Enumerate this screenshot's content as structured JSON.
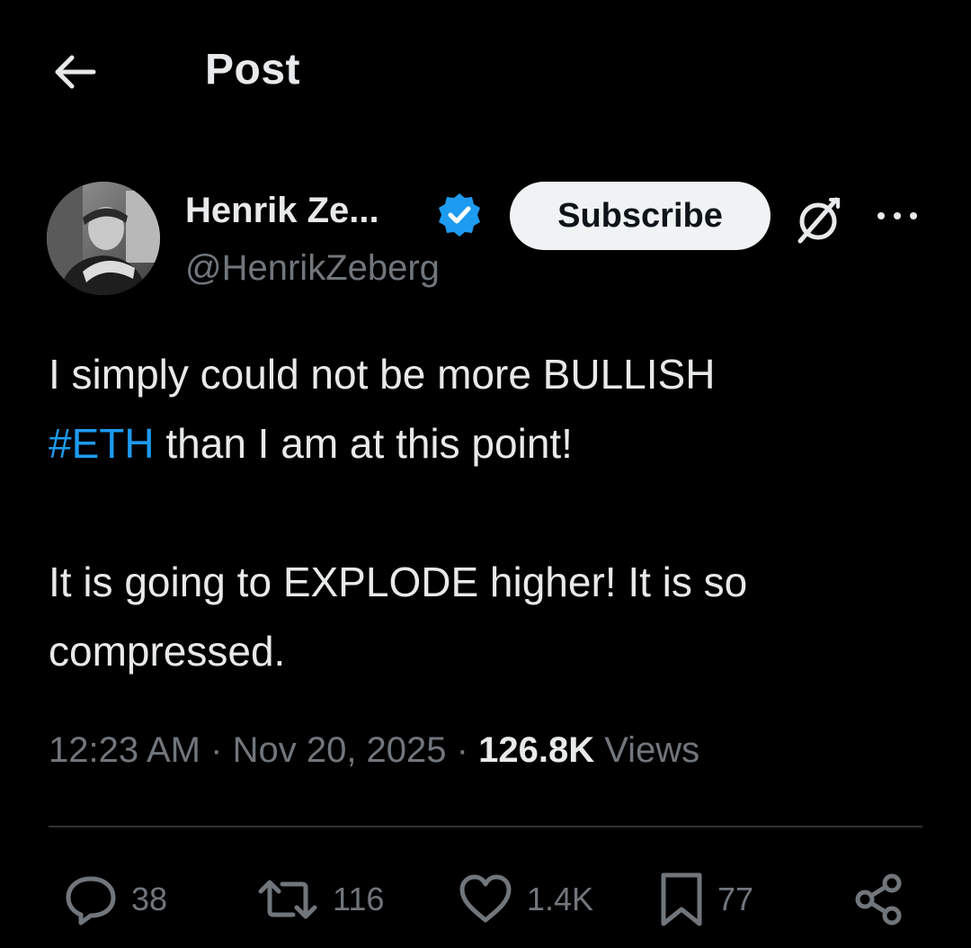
{
  "header": {
    "title": "Post"
  },
  "author": {
    "name": "Henrik Ze...",
    "handle": "@HenrikZeberg",
    "verified": true
  },
  "subscribe": {
    "label": "Subscribe"
  },
  "tweet": {
    "line1_text": "I simply could not be more BULLISH",
    "hashtag": "#ETH",
    "line2_rest": " than I am at this point!",
    "para2_line1": "It is going to EXPLODE higher! It is so",
    "para2_line2": "compressed."
  },
  "meta": {
    "time": "12:23 AM",
    "date": "Nov 20, 2025",
    "views_count": "126.8K",
    "views_label": "Views"
  },
  "actions": {
    "replies": "38",
    "reposts": "116",
    "likes": "1.4K",
    "bookmarks": "77"
  },
  "icons": {
    "back": "arrow-left-icon",
    "verified": "verified-badge-icon",
    "grok": "grok-icon",
    "more": "more-icon",
    "reply": "reply-icon",
    "repost": "repost-icon",
    "like": "heart-icon",
    "bookmark": "bookmark-icon",
    "share": "share-icon"
  },
  "colors": {
    "background": "#000000",
    "text": "#e7e9ea",
    "secondary": "#71767b",
    "accent": "#1d9bf0",
    "button_bg": "#eff3f4"
  }
}
